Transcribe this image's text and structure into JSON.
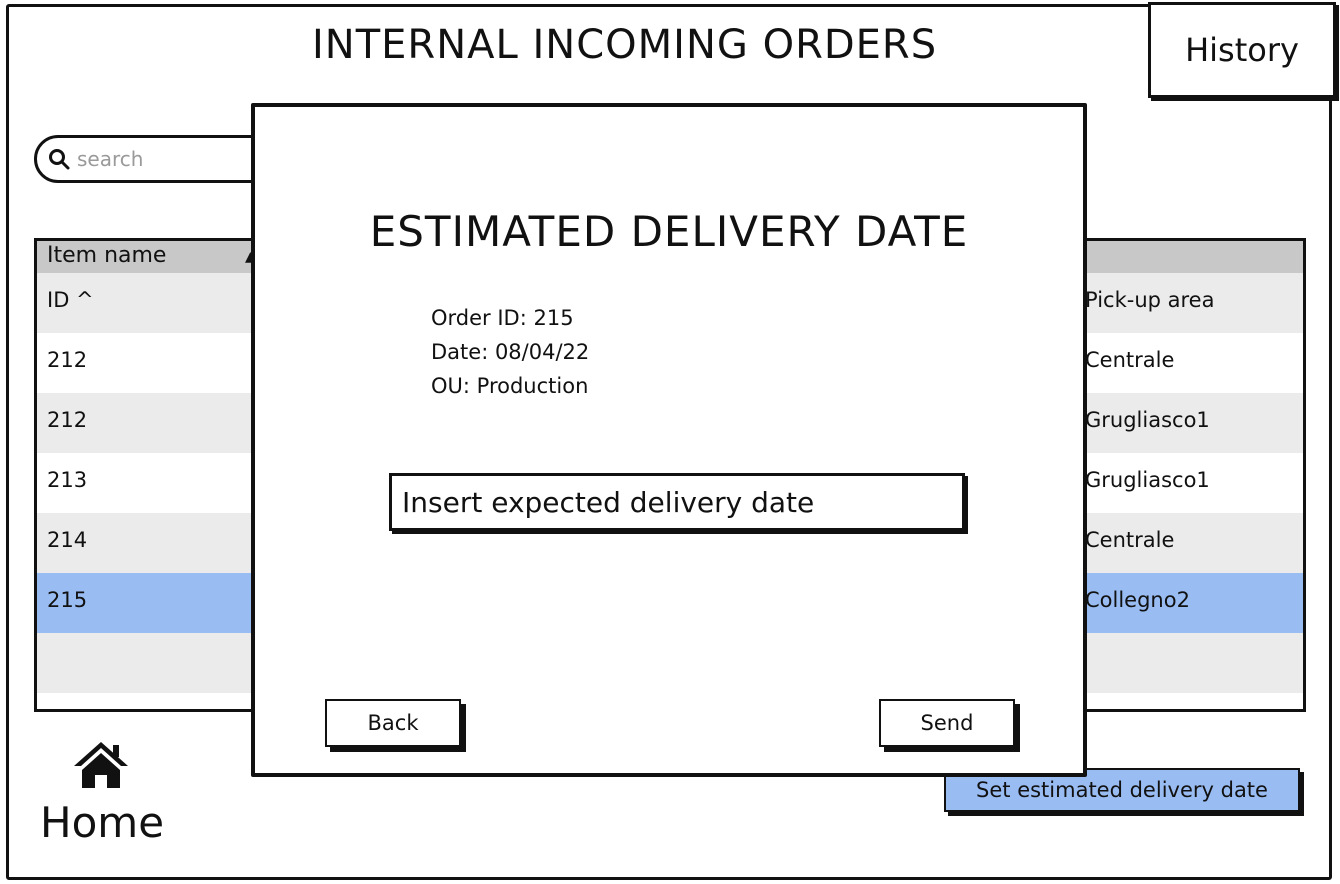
{
  "header": {
    "title": "INTERNAL INCOMING ORDERS",
    "history_label": "History"
  },
  "search": {
    "placeholder": "search",
    "icon": "search-icon"
  },
  "table": {
    "header_label": "Item name",
    "rows": [
      {
        "left": "ID ^",
        "right": "Pick-up area",
        "style": "alt"
      },
      {
        "left": "212",
        "right": "Centrale",
        "style": "white"
      },
      {
        "left": "212",
        "right": "Grugliasco1",
        "style": "alt"
      },
      {
        "left": "213",
        "right": "Grugliasco1",
        "style": "white"
      },
      {
        "left": "214",
        "right": "Centrale",
        "style": "alt"
      },
      {
        "left": "215",
        "right": "Collegno2",
        "style": "selected"
      },
      {
        "left": "",
        "right": "",
        "style": "alt"
      }
    ]
  },
  "footer": {
    "home_label": "Home",
    "home_icon": "home-icon",
    "set_date_label": "Set estimated delivery date"
  },
  "modal": {
    "title": "ESTIMATED DELIVERY DATE",
    "order_id": "Order ID: 215",
    "date": "Date: 08/04/22",
    "ou": "OU: Production",
    "input_placeholder": "Insert expected delivery date",
    "back_label": "Back",
    "send_label": "Send"
  },
  "colors": {
    "selected_row": "#99bdf3",
    "header_row": "#c8c8c8",
    "alt_row": "#ebebeb",
    "accent_button": "#99bdf3"
  }
}
